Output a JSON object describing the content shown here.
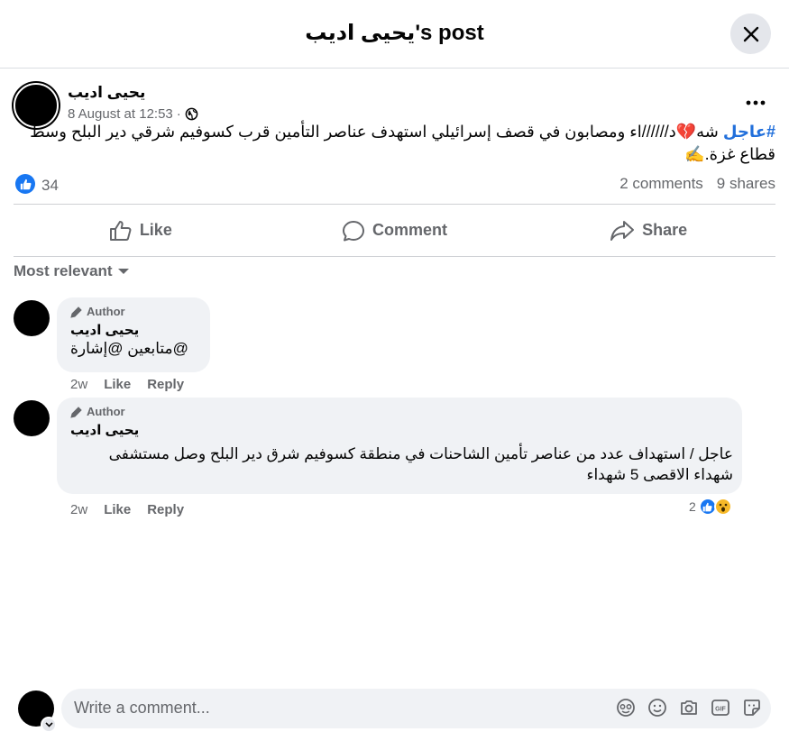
{
  "header": {
    "title": "يحيى اديب's post",
    "close_icon": "close-icon"
  },
  "post": {
    "author": "يحيى اديب",
    "time": "8 August at 12:53",
    "separator": "·",
    "privacy_icon": "globe-icon",
    "hashtag": "#عاجل",
    "text": " شه💔د//////اء ومصابون في قصف إسرائيلي استهدف عناصر التأمين قرب كسوفيم شرقي دير البلح وسط قطاع غزة.✍️",
    "like_count": "34",
    "comments_count": "2 comments",
    "shares_count": "9 shares"
  },
  "actions": {
    "like": "Like",
    "comment": "Comment",
    "share": "Share"
  },
  "sort": {
    "label": "Most relevant"
  },
  "comments": [
    {
      "tag": "Author",
      "name": "يحيى اديب",
      "text": "@متابعين @إشارة",
      "time": "2w",
      "like": "Like",
      "reply": "Reply"
    },
    {
      "tag": "Author",
      "name": "يحيى اديب",
      "text": "عاجل / استهداف عدد من عناصر تأمين الشاحنات في منطقة كسوفيم شرق دير البلح وصل مستشفى شهداء الاقصى 5 شهداء",
      "time": "2w",
      "like": "Like",
      "reply": "Reply",
      "reaction_count": "2"
    }
  ],
  "composer": {
    "placeholder": "Write a comment..."
  },
  "colors": {
    "accent": "#1877f2",
    "hashtag": "#216fdb",
    "muted": "#65676b",
    "bubble": "#f0f2f5"
  }
}
